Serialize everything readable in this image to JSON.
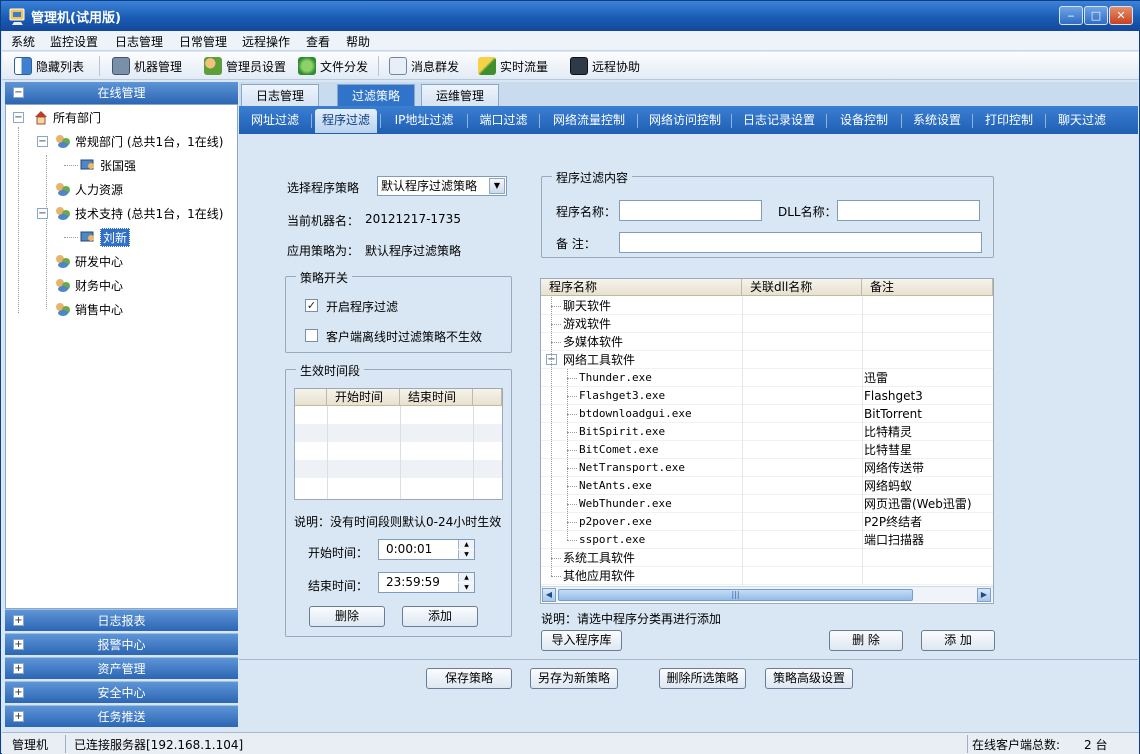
{
  "window": {
    "title": "管理机(试用版)",
    "minimize": "‒",
    "maximize": "□",
    "close": "✕"
  },
  "menu": [
    "系统",
    "监控设置",
    "日志管理",
    "日常管理",
    "远程操作",
    "查看",
    "帮助"
  ],
  "toolbar": [
    "隐藏列表",
    "机器管理",
    "管理员设置",
    "文件分发",
    "消息群发",
    "实时流量",
    "远程协助"
  ],
  "left_panel": {
    "header": "在线管理",
    "tree": {
      "root": "所有部门",
      "dept1": "常规部门 (总共1台，1在线)",
      "dept1_child": "张国强",
      "dept2": "人力资源",
      "dept3": "技术支持 (总共1台，1在线)",
      "dept3_child": "刘新",
      "dept4": "研发中心",
      "dept5": "财务中心",
      "dept6": "销售中心"
    },
    "bottom_bars": [
      "日志报表",
      "报警中心",
      "资产管理",
      "安全中心",
      "任务推送"
    ]
  },
  "main_tabs": [
    "日志管理",
    "过滤策略",
    "运维管理"
  ],
  "sub_tabs": [
    "网址过滤",
    "程序过滤",
    "IP地址过滤",
    "端口过滤",
    "网络流量控制",
    "网络访问控制",
    "日志记录设置",
    "设备控制",
    "系统设置",
    "打印控制",
    "聊天过滤"
  ],
  "policy": {
    "select_label": "选择程序策略",
    "select_value": "默认程序过滤策略",
    "machine_label": "当前机器名：",
    "machine_value": "20121217-1735",
    "apply_label": "应用策略为：",
    "apply_value": "默认程序过滤策略",
    "switch_group": "策略开关",
    "chk_enable": "开启程序过滤",
    "chk_enable_checked": "✓",
    "chk_offline": "客户端离线时过滤策略不生效",
    "chk_offline_checked": ""
  },
  "time_section": {
    "group": "生效时间段",
    "col_start": "开始时间",
    "col_end": "结束时间",
    "note": "说明：没有时间段则默认0-24小时生效",
    "start_label": "开始时间：",
    "start_value": "0:00:01",
    "end_label": "结束时间：",
    "end_value": "23:59:59",
    "delete_btn": "删除",
    "add_btn": "添加"
  },
  "filter_content": {
    "group": "程序过滤内容",
    "prog_name_label": "程序名称：",
    "prog_name_value": "",
    "dll_label": "DLL名称：",
    "dll_value": "",
    "remark_label": "备 注：",
    "remark_value": ""
  },
  "program_tree": {
    "headers": [
      "程序名称",
      "关联dll名称",
      "备注"
    ],
    "rows": [
      {
        "name": "聊天软件",
        "dll": "",
        "remark": "",
        "level": 0
      },
      {
        "name": "游戏软件",
        "dll": "",
        "remark": "",
        "level": 0
      },
      {
        "name": "多媒体软件",
        "dll": "",
        "remark": "",
        "level": 0
      },
      {
        "name": "网络工具软件",
        "dll": "",
        "remark": "",
        "level": 0,
        "expanded": true
      },
      {
        "name": "Thunder.exe",
        "dll": "",
        "remark": "迅雷",
        "level": 1
      },
      {
        "name": "Flashget3.exe",
        "dll": "",
        "remark": "Flashget3",
        "level": 1
      },
      {
        "name": "btdownloadgui.exe",
        "dll": "",
        "remark": "BitTorrent",
        "level": 1
      },
      {
        "name": "BitSpirit.exe",
        "dll": "",
        "remark": "比特精灵",
        "level": 1
      },
      {
        "name": "BitComet.exe",
        "dll": "",
        "remark": "比特彗星",
        "level": 1
      },
      {
        "name": "NetTransport.exe",
        "dll": "",
        "remark": "网络传送带",
        "level": 1
      },
      {
        "name": "NetAnts.exe",
        "dll": "",
        "remark": "网络蚂蚁",
        "level": 1
      },
      {
        "name": "WebThunder.exe",
        "dll": "",
        "remark": "网页迅雷(Web迅雷)",
        "level": 1
      },
      {
        "name": "p2pover.exe",
        "dll": "",
        "remark": "P2P终结者",
        "level": 1
      },
      {
        "name": "ssport.exe",
        "dll": "",
        "remark": "端口扫描器",
        "level": 1
      },
      {
        "name": "系统工具软件",
        "dll": "",
        "remark": "",
        "level": 0
      },
      {
        "name": "其他应用软件",
        "dll": "",
        "remark": "",
        "level": 0
      }
    ],
    "note": "说明：请选中程序分类再进行添加",
    "import_btn": "导入程序库",
    "delete_btn": "删 除",
    "add_btn": "添 加"
  },
  "bottom_buttons": [
    "保存策略",
    "另存为新策略",
    "删除所选策略",
    "策略高级设置"
  ],
  "status": {
    "role": "管理机",
    "connection": "已连接服务器[192.168.1.104]",
    "online_label": "在线客户端总数:",
    "online_count": "2 台"
  },
  "colors": {
    "title_bar": "#1a5cb4",
    "tab_bar": "#2f74c9",
    "panel_bg": "#d9e6f3"
  }
}
